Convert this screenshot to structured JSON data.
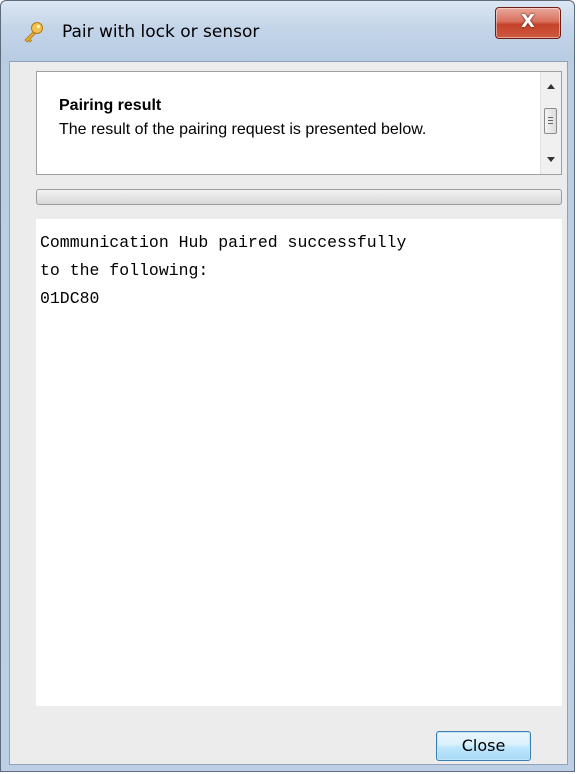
{
  "window": {
    "title": "Pair with lock or sensor",
    "close_glyph": "X",
    "title_icon": "key-icon"
  },
  "header": {
    "title": "Pairing result",
    "description": "The result of the pairing request is presented below."
  },
  "progress": {
    "fraction": 0
  },
  "output": {
    "lines": [
      "Communication Hub paired successfully",
      "to the following:",
      "01DC80"
    ]
  },
  "footer": {
    "close_label": "Close"
  },
  "colors": {
    "accent_close": "#c4412a",
    "button_border": "#3c7fb1"
  }
}
